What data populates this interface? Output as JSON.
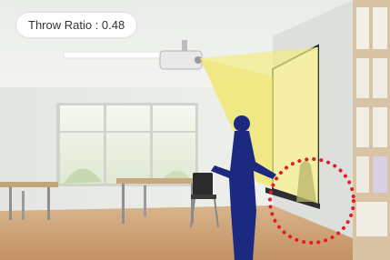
{
  "badge": {
    "label": "Throw Ratio : 0.48"
  },
  "scene": {
    "subject": "classroom-projector-shadow-illustration",
    "highlight_color": "#e01e24",
    "beam_color": "#f3ec86",
    "person_color": "#1b2a80"
  }
}
